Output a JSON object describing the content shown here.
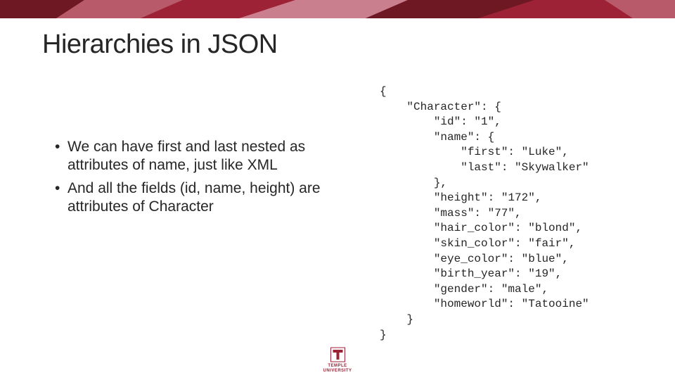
{
  "colors": {
    "temple_cherry": "#9d2235",
    "dark_red": "#6e1824",
    "accent1": "#b85a6a",
    "accent2": "#c97f8e"
  },
  "title": "Hierarchies in JSON",
  "bullets": [
    "We can have first and last nested as attributes of name, just like XML",
    "And all the fields (id, name, height) are attributes of Character"
  ],
  "code": "{\n    \"Character\": {\n        \"id\": \"1\",\n        \"name\": {\n            \"first\": \"Luke\",\n            \"last\": \"Skywalker\"\n        },\n        \"height\": \"172\",\n        \"mass\": \"77\",\n        \"hair_color\": \"blond\",\n        \"skin_color\": \"fair\",\n        \"eye_color\": \"blue\",\n        \"birth_year\": \"19\",\n        \"gender\": \"male\",\n        \"homeworld\": \"Tatooine\"\n    }\n}",
  "logo_label": "TEMPLE",
  "logo_sub": "UNIVERSITY"
}
